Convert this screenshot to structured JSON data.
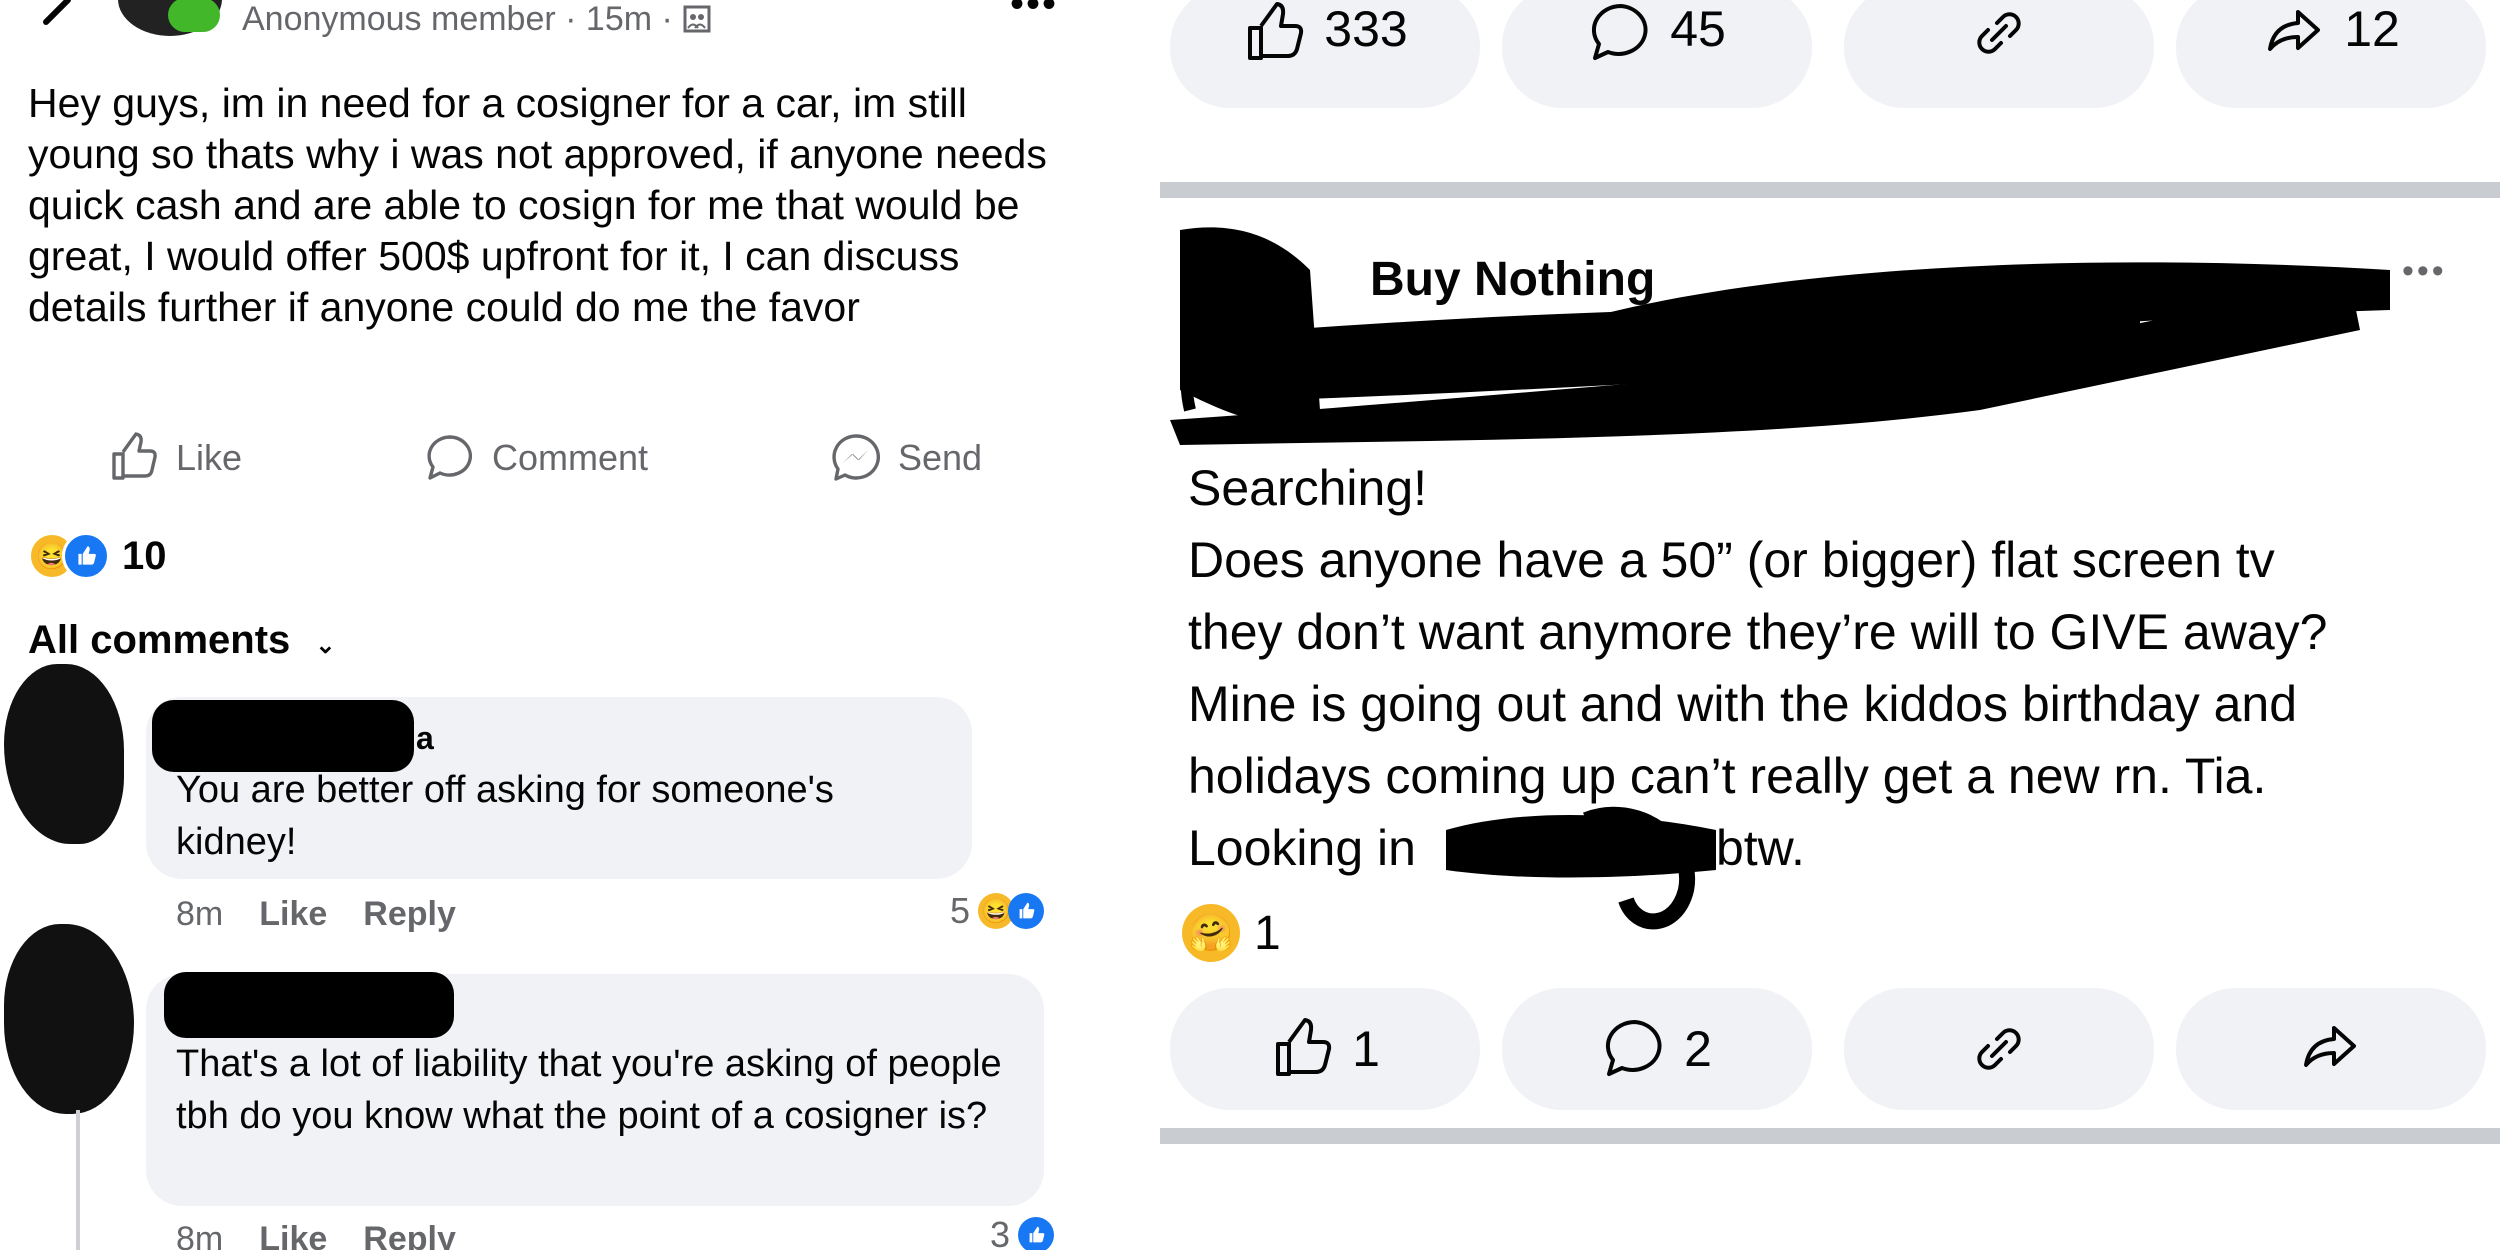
{
  "left_post": {
    "author": "Anonymous member",
    "time": "15m",
    "separator": "·",
    "body": "Hey guys, im in need for a cosigner for a car, im still young so thats why i was not approved, if anyone needs quick cash and are able to cosign for me that would be great, I would offer 500$ upfront for it, I can discuss details further if anyone could do me the favor",
    "actions": {
      "like": "Like",
      "comment": "Comment",
      "send": "Send"
    },
    "reaction_count": "10",
    "comments_filter": "All comments",
    "comments": [
      {
        "name_suffix": "a",
        "text": "You are better off asking for someone's kidney!",
        "time": "8m",
        "like": "Like",
        "reply": "Reply",
        "reactions": "5"
      },
      {
        "text": "That's a lot of liability that you're asking of people tbh do you know what the point of a cosigner is?",
        "time": "8m",
        "like": "Like",
        "reply": "Reply",
        "reactions": "3"
      }
    ]
  },
  "right_post": {
    "top_counts": {
      "like": "333",
      "comment": "45",
      "share": "12"
    },
    "group_name": "Buy Nothing",
    "more": "•••",
    "lines": [
      "Searching!",
      "Does anyone have a 50” (or bigger) flat screen tv",
      "they don’t want anymore they’re will to GIVE away?",
      "Mine is going out and with the kiddos birthday and",
      "holidays coming up can’t really get a new rn. Tia.",
      "Looking in",
      "btw."
    ],
    "reaction_count": "1",
    "like_count": "1",
    "comment_count": "2"
  },
  "colors": {
    "text": "#050505",
    "muted": "#65676b",
    "bubble": "#f0f2f5",
    "blue": "#1877f2",
    "divider": "#c9ccd1"
  },
  "icons": [
    "back-chevron-icon",
    "avatar-group-icon",
    "group-badge-icon",
    "more-icon",
    "like-thumb-icon",
    "comment-bubble-icon",
    "messenger-send-icon",
    "link-icon",
    "share-arrow-icon",
    "haha-emoji-icon",
    "like-emoji-icon",
    "care-emoji-icon"
  ]
}
